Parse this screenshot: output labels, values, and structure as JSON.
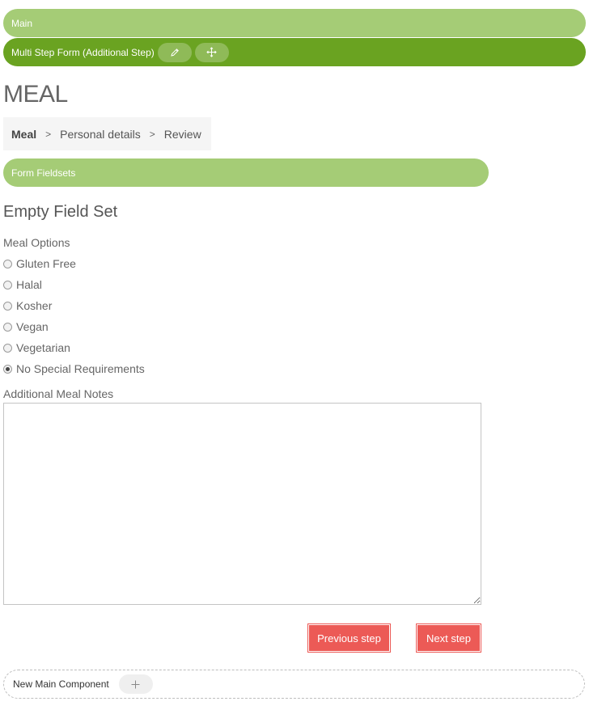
{
  "editor": {
    "main_label": "Main",
    "form_label": "Multi Step Form (Additional Step)",
    "edit_icon": "pencil-icon",
    "move_icon": "move-icon",
    "fieldsets_label": "Form Fieldsets",
    "new_component_label": "New Main Component",
    "add_icon": "plus-icon"
  },
  "page": {
    "title": "MEAL"
  },
  "steps": {
    "items": [
      {
        "label": "Meal",
        "active": true
      },
      {
        "label": "Personal details",
        "active": false
      },
      {
        "label": "Review",
        "active": false
      }
    ],
    "separator": ">"
  },
  "fieldset": {
    "legend": "Empty Field Set",
    "group_label": "Meal Options",
    "options": [
      {
        "label": "Gluten Free",
        "checked": false
      },
      {
        "label": "Halal",
        "checked": false
      },
      {
        "label": "Kosher",
        "checked": false
      },
      {
        "label": "Vegan",
        "checked": false
      },
      {
        "label": "Vegetarian",
        "checked": false
      },
      {
        "label": "No Special Requirements",
        "checked": true
      }
    ],
    "notes_label": "Additional Meal Notes",
    "notes_value": ""
  },
  "actions": {
    "previous_label": "Previous step",
    "next_label": "Next step"
  },
  "colors": {
    "light_green": "#a5cc76",
    "dark_green": "#6aa321",
    "button_red": "#ec5a56"
  }
}
